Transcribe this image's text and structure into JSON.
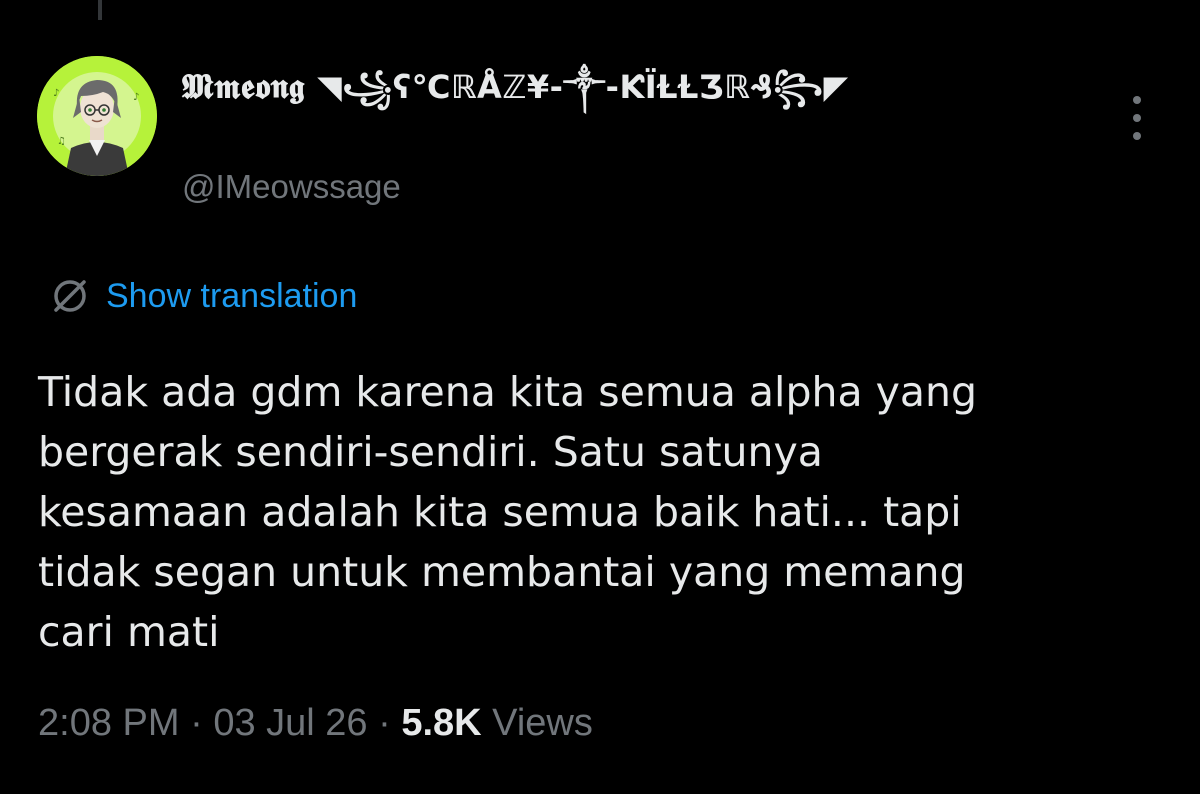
{
  "tweet": {
    "display_name": "𝕸𝖒𝖊𝖔𝖓𝖌",
    "display_name_decoration": "◥꧁ʕ℃ℝÅℤ¥-༒-ƘÏⱢⱢƷℝ₰꧂◤",
    "handle": "@IMeowssage",
    "translation_label": "Show translation",
    "text": "Tidak ada gdm karena kita semua alpha yang\nbergerak sendiri-sendiri. Satu satunya\nkesamaan adalah kita semua baik hati... tapi\ntidak segan untuk membantai yang memang\ncari mati",
    "time": "2:08 PM",
    "date": "03 Jul 26",
    "separator": "·",
    "views_count": "5.8K",
    "views_label": "Views"
  },
  "icons": {
    "more": "more-vertical-icon",
    "translate": "globe-slash-icon"
  },
  "colors": {
    "background": "#000000",
    "text": "#e7e9ea",
    "secondary": "#71767b",
    "link": "#1d9bf0",
    "avatar_bg": "#b6f23a"
  }
}
